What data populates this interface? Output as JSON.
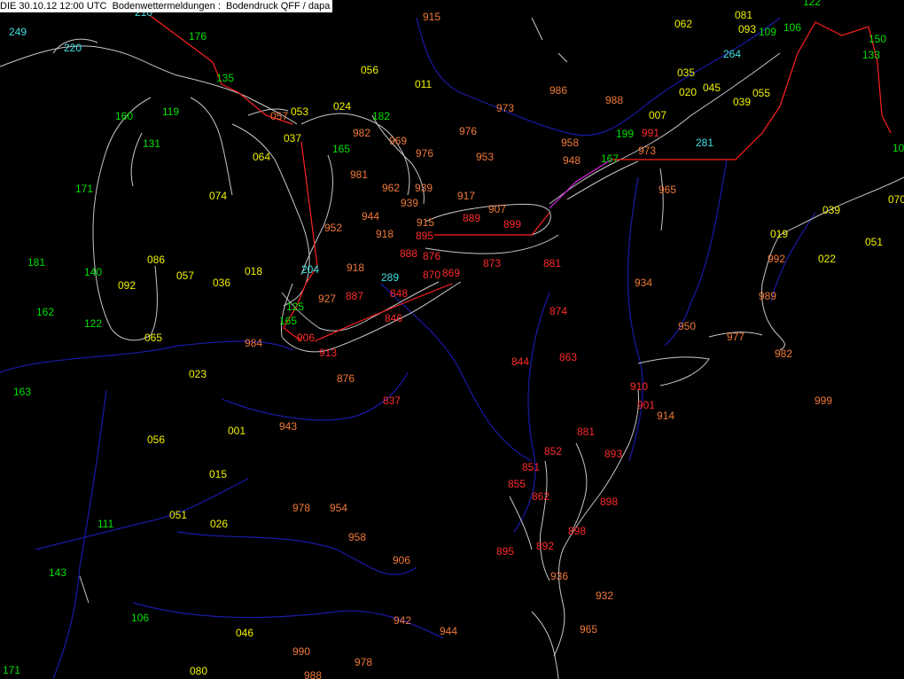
{
  "header": {
    "title": "DIE 30.10.12 12:00 UTC  Bodenwettermeldungen :  Bodendruck QFF / dapa"
  },
  "colors": {
    "background": "#000000",
    "coastline": "#c8c8c8",
    "river": "#1a1aa8",
    "border_red": "#ff2020",
    "border_magenta": "#e020e0",
    "green": "#00e000",
    "cyan": "#40e0e0",
    "yellow": "#f0f000",
    "orange": "#f07838",
    "red": "#ff2a2a"
  },
  "stations": [
    {
      "v": "249",
      "c": "cyan"
    },
    {
      "v": "220",
      "c": "cyan"
    },
    {
      "v": "210",
      "c": "cyan"
    },
    {
      "v": "176",
      "c": "green"
    },
    {
      "v": "135",
      "c": "green"
    },
    {
      "v": "160",
      "c": "green"
    },
    {
      "v": "119",
      "c": "green"
    },
    {
      "v": "131",
      "c": "green"
    },
    {
      "v": "171",
      "c": "green"
    },
    {
      "v": "181",
      "c": "green"
    },
    {
      "v": "140",
      "c": "green"
    },
    {
      "v": "162",
      "c": "green"
    },
    {
      "v": "122",
      "c": "green"
    },
    {
      "v": "163",
      "c": "green"
    },
    {
      "v": "111",
      "c": "green"
    },
    {
      "v": "143",
      "c": "green"
    },
    {
      "v": "106",
      "c": "green"
    },
    {
      "v": "171",
      "c": "green"
    },
    {
      "v": "182",
      "c": "green"
    },
    {
      "v": "165",
      "c": "green"
    },
    {
      "v": "125",
      "c": "green"
    },
    {
      "v": "165",
      "c": "green"
    },
    {
      "v": "199",
      "c": "green"
    },
    {
      "v": "167",
      "c": "green"
    },
    {
      "v": "109",
      "c": "green"
    },
    {
      "v": "106",
      "c": "green"
    },
    {
      "v": "122",
      "c": "green"
    },
    {
      "v": "150",
      "c": "green"
    },
    {
      "v": "133",
      "c": "green"
    },
    {
      "v": "10",
      "c": "green"
    },
    {
      "v": "204",
      "c": "cyan"
    },
    {
      "v": "289",
      "c": "cyan"
    },
    {
      "v": "264",
      "c": "cyan"
    },
    {
      "v": "281",
      "c": "cyan"
    },
    {
      "v": "056",
      "c": "yellow"
    },
    {
      "v": "011",
      "c": "yellow"
    },
    {
      "v": "024",
      "c": "yellow"
    },
    {
      "v": "053",
      "c": "yellow"
    },
    {
      "v": "057",
      "c": "orange"
    },
    {
      "v": "037",
      "c": "yellow"
    },
    {
      "v": "064",
      "c": "yellow"
    },
    {
      "v": "074",
      "c": "yellow"
    },
    {
      "v": "086",
      "c": "yellow"
    },
    {
      "v": "092",
      "c": "yellow"
    },
    {
      "v": "057",
      "c": "yellow"
    },
    {
      "v": "036",
      "c": "yellow"
    },
    {
      "v": "018",
      "c": "yellow"
    },
    {
      "v": "065",
      "c": "yellow"
    },
    {
      "v": "023",
      "c": "yellow"
    },
    {
      "v": "056",
      "c": "yellow"
    },
    {
      "v": "001",
      "c": "yellow"
    },
    {
      "v": "015",
      "c": "yellow"
    },
    {
      "v": "051",
      "c": "yellow"
    },
    {
      "v": "026",
      "c": "yellow"
    },
    {
      "v": "046",
      "c": "yellow"
    },
    {
      "v": "080",
      "c": "yellow"
    },
    {
      "v": "062",
      "c": "yellow"
    },
    {
      "v": "081",
      "c": "yellow"
    },
    {
      "v": "093",
      "c": "yellow"
    },
    {
      "v": "035",
      "c": "yellow"
    },
    {
      "v": "020",
      "c": "yellow"
    },
    {
      "v": "045",
      "c": "yellow"
    },
    {
      "v": "055",
      "c": "yellow"
    },
    {
      "v": "039",
      "c": "yellow"
    },
    {
      "v": "007",
      "c": "yellow"
    },
    {
      "v": "039",
      "c": "yellow"
    },
    {
      "v": "019",
      "c": "yellow"
    },
    {
      "v": "051",
      "c": "yellow"
    },
    {
      "v": "022",
      "c": "yellow"
    },
    {
      "v": "070",
      "c": "yellow"
    },
    {
      "v": "915",
      "c": "orange"
    },
    {
      "v": "986",
      "c": "orange"
    },
    {
      "v": "988",
      "c": "orange"
    },
    {
      "v": "973",
      "c": "orange"
    },
    {
      "v": "976",
      "c": "orange"
    },
    {
      "v": "982",
      "c": "orange"
    },
    {
      "v": "969",
      "c": "orange"
    },
    {
      "v": "976",
      "c": "orange"
    },
    {
      "v": "953",
      "c": "orange"
    },
    {
      "v": "958",
      "c": "orange"
    },
    {
      "v": "948",
      "c": "orange"
    },
    {
      "v": "991",
      "c": "red"
    },
    {
      "v": "973",
      "c": "orange"
    },
    {
      "v": "981",
      "c": "orange"
    },
    {
      "v": "962",
      "c": "orange"
    },
    {
      "v": "939",
      "c": "orange"
    },
    {
      "v": "939",
      "c": "orange"
    },
    {
      "v": "917",
      "c": "orange"
    },
    {
      "v": "907",
      "c": "orange"
    },
    {
      "v": "944",
      "c": "orange"
    },
    {
      "v": "952",
      "c": "orange"
    },
    {
      "v": "918",
      "c": "orange"
    },
    {
      "v": "915",
      "c": "orange"
    },
    {
      "v": "889",
      "c": "red"
    },
    {
      "v": "899",
      "c": "red"
    },
    {
      "v": "895",
      "c": "red"
    },
    {
      "v": "888",
      "c": "red"
    },
    {
      "v": "876",
      "c": "red"
    },
    {
      "v": "873",
      "c": "red"
    },
    {
      "v": "881",
      "c": "red"
    },
    {
      "v": "918",
      "c": "orange"
    },
    {
      "v": "870",
      "c": "red"
    },
    {
      "v": "869",
      "c": "red"
    },
    {
      "v": "927",
      "c": "orange"
    },
    {
      "v": "887",
      "c": "red"
    },
    {
      "v": "848",
      "c": "red"
    },
    {
      "v": "846",
      "c": "red"
    },
    {
      "v": "906",
      "c": "red"
    },
    {
      "v": "913",
      "c": "red"
    },
    {
      "v": "984",
      "c": "orange"
    },
    {
      "v": "876",
      "c": "orange"
    },
    {
      "v": "837",
      "c": "red"
    },
    {
      "v": "943",
      "c": "orange"
    },
    {
      "v": "844",
      "c": "red"
    },
    {
      "v": "863",
      "c": "red"
    },
    {
      "v": "874",
      "c": "red"
    },
    {
      "v": "934",
      "c": "orange"
    },
    {
      "v": "965",
      "c": "orange"
    },
    {
      "v": "950",
      "c": "orange"
    },
    {
      "v": "977",
      "c": "orange"
    },
    {
      "v": "982",
      "c": "orange"
    },
    {
      "v": "992",
      "c": "orange"
    },
    {
      "v": "989",
      "c": "orange"
    },
    {
      "v": "999",
      "c": "orange"
    },
    {
      "v": "910",
      "c": "red"
    },
    {
      "v": "901",
      "c": "red"
    },
    {
      "v": "914",
      "c": "orange"
    },
    {
      "v": "881",
      "c": "red"
    },
    {
      "v": "893",
      "c": "red"
    },
    {
      "v": "852",
      "c": "red"
    },
    {
      "v": "851",
      "c": "red"
    },
    {
      "v": "855",
      "c": "red"
    },
    {
      "v": "862",
      "c": "red"
    },
    {
      "v": "898",
      "c": "red"
    },
    {
      "v": "898",
      "c": "red"
    },
    {
      "v": "895",
      "c": "red"
    },
    {
      "v": "892",
      "c": "red"
    },
    {
      "v": "936",
      "c": "orange"
    },
    {
      "v": "932",
      "c": "orange"
    },
    {
      "v": "965",
      "c": "orange"
    },
    {
      "v": "978",
      "c": "orange"
    },
    {
      "v": "954",
      "c": "orange"
    },
    {
      "v": "958",
      "c": "orange"
    },
    {
      "v": "906",
      "c": "orange"
    },
    {
      "v": "942",
      "c": "orange"
    },
    {
      "v": "944",
      "c": "orange"
    },
    {
      "v": "990",
      "c": "orange"
    },
    {
      "v": "978",
      "c": "orange"
    },
    {
      "v": "988",
      "c": "orange"
    }
  ]
}
